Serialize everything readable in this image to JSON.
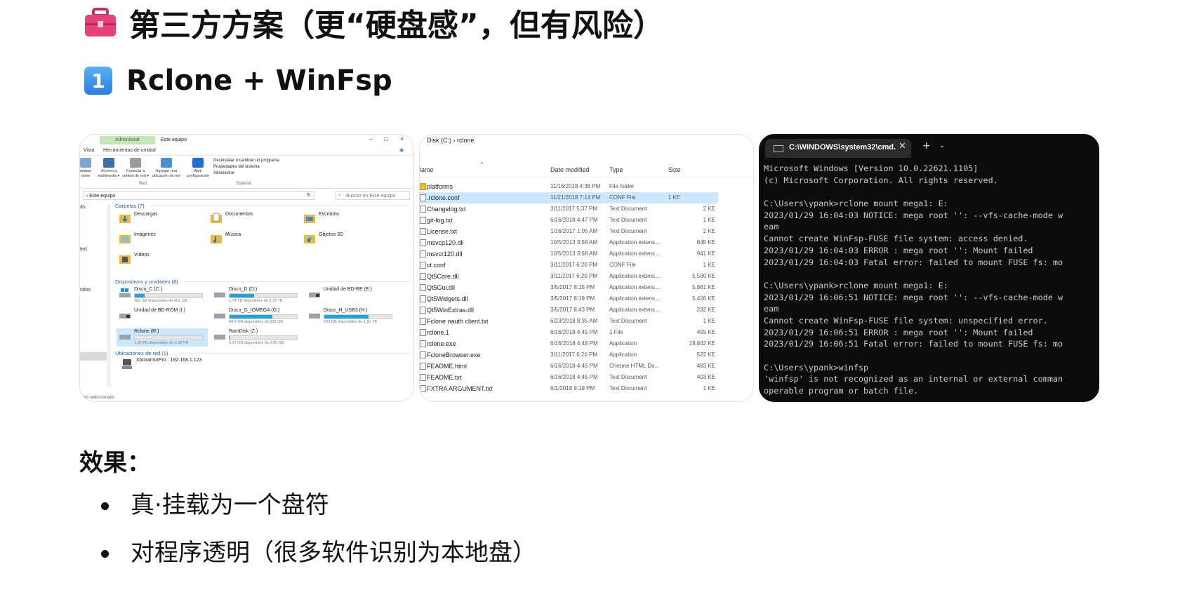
{
  "heading": {
    "title": "第三方方案（更“硬盘感”，但有风险）",
    "icon": "toolbox-icon",
    "icon_color": "#e8407a"
  },
  "subheading": {
    "number": "1",
    "title": "Rclone + WinFsp",
    "icon": "keycap-one-icon",
    "badge_color": "#3b8fe8"
  },
  "explorer": {
    "context_tab": "Administrar",
    "window_title": "Este equipo",
    "ribbon_tabs": [
      "Vista",
      "Herramientas de unidad"
    ],
    "ribbon_buttons": [
      {
        "label": "ambiar\nmbre"
      },
      {
        "label": "Acceso a\nmultimedia ▾"
      },
      {
        "label": "Conectar a\nunidad de red ▾"
      },
      {
        "label": "Agregar una\nubicación de red"
      },
      {
        "label": "Abrir\nconfiguración"
      }
    ],
    "ribbon_links": [
      "Desinstalar o cambiar un programa",
      "Propiedades del sistema",
      "Administrar"
    ],
    "ribbon_groups": [
      "Red",
      "Sistema"
    ],
    "address": "› Este equipo",
    "search_placeholder": "Buscar en Este equipo",
    "nav_items": [
      "ás",
      "ted",
      "ndos"
    ],
    "section_folders": "Carpetas (7)",
    "folders": [
      "Descargas",
      "Documentos",
      "Escritorio",
      "Imágenes",
      "Música",
      "Objetos 3D",
      "Vídeos"
    ],
    "section_drives": "Dispositivos y unidades (8)",
    "drives": [
      {
        "name": "Disco_C (C:)",
        "sub": "382 GB disponibles de 451 GB",
        "used": 0.15
      },
      {
        "name": "Disco_D (D:)",
        "sub": "1,74 TB disponibles de 2,72 TB",
        "used": 0.36
      },
      {
        "name": "Unidad de BD-RE (E:)",
        "sub": "",
        "used": null
      },
      {
        "name": "Unidad de BD-ROM (I:)",
        "sub": "",
        "used": null
      },
      {
        "name": "Disco_G_IOMEGA (G:)",
        "sub": "84,6 GB disponibles de 232 GB",
        "used": 0.64
      },
      {
        "name": "Disco_H_USB3 (H:)",
        "sub": "633 GB disponibles de 1,81 TB",
        "used": 0.66
      },
      {
        "name": "Rclone (R:)",
        "sub": "1,00 PB disponibles de 1,00 PB",
        "used": 0.0
      },
      {
        "name": "RamDisk (Z:)",
        "sub": "3,97 GB disponibles de 3,99 GB",
        "used": 0.01
      }
    ],
    "section_network": "Ubicaciones de red (1)",
    "network_item": "XboxamorPro : 192.168.1.123",
    "status": "nto seleccionado"
  },
  "filelist": {
    "breadcrumb": "Disk (C:)  ›  rclone",
    "columns": [
      "lame",
      "Date modified",
      "Type",
      "Size"
    ],
    "rows": [
      [
        "platforms",
        "11/16/2018 4:38 PM",
        "File folder",
        ""
      ],
      [
        ".rclone.conf",
        "11/21/2018 7:14 PM",
        "CONF File",
        "1 KE"
      ],
      [
        "Changelog.txt",
        "3/11/2017 5:37 PM",
        "Text Document",
        "2 KE"
      ],
      [
        "git-log.txt",
        "6/16/2018 4:47 PM",
        "Text Document",
        "1 KE"
      ],
      [
        "License.txt",
        "1/16/2017 1:05 AM",
        "Text Document",
        "2 KE"
      ],
      [
        "msvcp120.dll",
        "10/5/2013 3:58 AM",
        "Application extens...",
        "645 KE"
      ],
      [
        "msvcr120.dll",
        "10/5/2013 3:58 AM",
        "Application extens...",
        "941 KE"
      ],
      [
        "ct.conf",
        "3/11/2017 6:20 PM",
        "CONF File",
        "1 KE"
      ],
      [
        "Qt5Core.dll",
        "3/11/2017 6:20 PM",
        "Application extens...",
        "5,590 KE"
      ],
      [
        "Qt5Gui.dll",
        "3/5/2017 8:15 PM",
        "Application extens...",
        "5,881 KE"
      ],
      [
        "Qt5Widgets.dll",
        "3/5/2017 8:19 PM",
        "Application extens...",
        "5,426 KE"
      ],
      [
        "Qt5WinExtras.dll",
        "3/5/2017 8:43 PM",
        "Application extens...",
        "232 KE"
      ],
      [
        "Fclone oauth client.txt",
        "6/23/2018 8:35 AM",
        "Text Document",
        "1 KE"
      ],
      [
        "rclone.1",
        "6/16/2018 4:45 PM",
        "1 File",
        "455 KE"
      ],
      [
        "rclone.exe",
        "6/16/2018 4:48 PM",
        "Application",
        "19,842 KE"
      ],
      [
        "FcloneBrowser.exe",
        "3/11/2017 6:20 PM",
        "Application",
        "522 KE"
      ],
      [
        "FEADME.html",
        "6/16/2018 4:45 PM",
        "Chrome HTML Do...",
        "483 KE"
      ],
      [
        "FEADME.txt",
        "6/16/2018 4:45 PM",
        "Text Document",
        "403 KE"
      ],
      [
        "FXTRA ARGUMENT.txt",
        "6/1/2018 9:19 PM",
        "Text Document",
        "1 KE"
      ]
    ]
  },
  "terminal": {
    "tab_title": "C:\\WINDOWS\\system32\\cmd.",
    "close": "✕",
    "new_tab": "+",
    "dropdown": "⌄",
    "lines": [
      "Microsoft Windows [Version 10.0.22621.1105]",
      "(c) Microsoft Corporation. All rights reserved.",
      "",
      "C:\\Users\\ypank>rclone mount mega1: E:",
      "2023/01/29 16:04:03 NOTICE: mega root '': --vfs-cache-mode w",
      "eam",
      "Cannot create WinFsp-FUSE file system: access denied.",
      "2023/01/29 16:04:03 ERROR : mega root '': Mount failed",
      "2023/01/29 16:04:03 Fatal error: failed to mount FUSE fs: mo",
      "",
      "C:\\Users\\ypank>rclone mount mega1: E:",
      "2023/01/29 16:06:51 NOTICE: mega root '': --vfs-cache-mode w",
      "eam",
      "Cannot create WinFsp-FUSE file system: unspecified error.",
      "2023/01/29 16:06:51 ERROR : mega root '': Mount failed",
      "2023/01/29 16:06:51 Fatal error: failed to mount FUSE fs: mo",
      "",
      "C:\\Users\\ypank>winfsp",
      "'winfsp' is not recognized as an internal or external comman",
      "operable program or batch file."
    ]
  },
  "effect": {
    "label": "效果：",
    "items": [
      "真·挂载为一个盘符",
      "对程序透明（很多软件识别为本地盘）"
    ]
  }
}
